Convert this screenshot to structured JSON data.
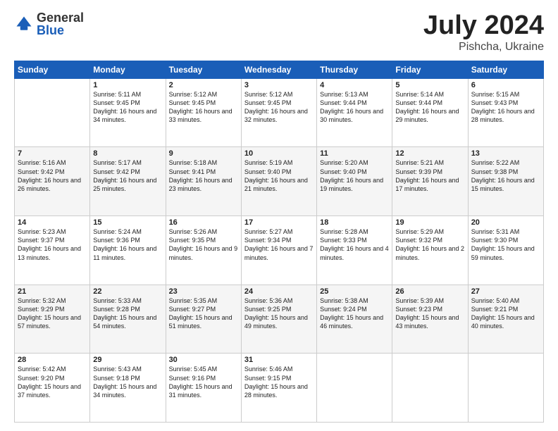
{
  "logo": {
    "general": "General",
    "blue": "Blue"
  },
  "title": {
    "month_year": "July 2024",
    "location": "Pishcha, Ukraine"
  },
  "days_of_week": [
    "Sunday",
    "Monday",
    "Tuesday",
    "Wednesday",
    "Thursday",
    "Friday",
    "Saturday"
  ],
  "weeks": [
    [
      {
        "day": "",
        "sunrise": "",
        "sunset": "",
        "daylight": ""
      },
      {
        "day": "1",
        "sunrise": "Sunrise: 5:11 AM",
        "sunset": "Sunset: 9:45 PM",
        "daylight": "Daylight: 16 hours and 34 minutes."
      },
      {
        "day": "2",
        "sunrise": "Sunrise: 5:12 AM",
        "sunset": "Sunset: 9:45 PM",
        "daylight": "Daylight: 16 hours and 33 minutes."
      },
      {
        "day": "3",
        "sunrise": "Sunrise: 5:12 AM",
        "sunset": "Sunset: 9:45 PM",
        "daylight": "Daylight: 16 hours and 32 minutes."
      },
      {
        "day": "4",
        "sunrise": "Sunrise: 5:13 AM",
        "sunset": "Sunset: 9:44 PM",
        "daylight": "Daylight: 16 hours and 30 minutes."
      },
      {
        "day": "5",
        "sunrise": "Sunrise: 5:14 AM",
        "sunset": "Sunset: 9:44 PM",
        "daylight": "Daylight: 16 hours and 29 minutes."
      },
      {
        "day": "6",
        "sunrise": "Sunrise: 5:15 AM",
        "sunset": "Sunset: 9:43 PM",
        "daylight": "Daylight: 16 hours and 28 minutes."
      }
    ],
    [
      {
        "day": "7",
        "sunrise": "Sunrise: 5:16 AM",
        "sunset": "Sunset: 9:42 PM",
        "daylight": "Daylight: 16 hours and 26 minutes."
      },
      {
        "day": "8",
        "sunrise": "Sunrise: 5:17 AM",
        "sunset": "Sunset: 9:42 PM",
        "daylight": "Daylight: 16 hours and 25 minutes."
      },
      {
        "day": "9",
        "sunrise": "Sunrise: 5:18 AM",
        "sunset": "Sunset: 9:41 PM",
        "daylight": "Daylight: 16 hours and 23 minutes."
      },
      {
        "day": "10",
        "sunrise": "Sunrise: 5:19 AM",
        "sunset": "Sunset: 9:40 PM",
        "daylight": "Daylight: 16 hours and 21 minutes."
      },
      {
        "day": "11",
        "sunrise": "Sunrise: 5:20 AM",
        "sunset": "Sunset: 9:40 PM",
        "daylight": "Daylight: 16 hours and 19 minutes."
      },
      {
        "day": "12",
        "sunrise": "Sunrise: 5:21 AM",
        "sunset": "Sunset: 9:39 PM",
        "daylight": "Daylight: 16 hours and 17 minutes."
      },
      {
        "day": "13",
        "sunrise": "Sunrise: 5:22 AM",
        "sunset": "Sunset: 9:38 PM",
        "daylight": "Daylight: 16 hours and 15 minutes."
      }
    ],
    [
      {
        "day": "14",
        "sunrise": "Sunrise: 5:23 AM",
        "sunset": "Sunset: 9:37 PM",
        "daylight": "Daylight: 16 hours and 13 minutes."
      },
      {
        "day": "15",
        "sunrise": "Sunrise: 5:24 AM",
        "sunset": "Sunset: 9:36 PM",
        "daylight": "Daylight: 16 hours and 11 minutes."
      },
      {
        "day": "16",
        "sunrise": "Sunrise: 5:26 AM",
        "sunset": "Sunset: 9:35 PM",
        "daylight": "Daylight: 16 hours and 9 minutes."
      },
      {
        "day": "17",
        "sunrise": "Sunrise: 5:27 AM",
        "sunset": "Sunset: 9:34 PM",
        "daylight": "Daylight: 16 hours and 7 minutes."
      },
      {
        "day": "18",
        "sunrise": "Sunrise: 5:28 AM",
        "sunset": "Sunset: 9:33 PM",
        "daylight": "Daylight: 16 hours and 4 minutes."
      },
      {
        "day": "19",
        "sunrise": "Sunrise: 5:29 AM",
        "sunset": "Sunset: 9:32 PM",
        "daylight": "Daylight: 16 hours and 2 minutes."
      },
      {
        "day": "20",
        "sunrise": "Sunrise: 5:31 AM",
        "sunset": "Sunset: 9:30 PM",
        "daylight": "Daylight: 15 hours and 59 minutes."
      }
    ],
    [
      {
        "day": "21",
        "sunrise": "Sunrise: 5:32 AM",
        "sunset": "Sunset: 9:29 PM",
        "daylight": "Daylight: 15 hours and 57 minutes."
      },
      {
        "day": "22",
        "sunrise": "Sunrise: 5:33 AM",
        "sunset": "Sunset: 9:28 PM",
        "daylight": "Daylight: 15 hours and 54 minutes."
      },
      {
        "day": "23",
        "sunrise": "Sunrise: 5:35 AM",
        "sunset": "Sunset: 9:27 PM",
        "daylight": "Daylight: 15 hours and 51 minutes."
      },
      {
        "day": "24",
        "sunrise": "Sunrise: 5:36 AM",
        "sunset": "Sunset: 9:25 PM",
        "daylight": "Daylight: 15 hours and 49 minutes."
      },
      {
        "day": "25",
        "sunrise": "Sunrise: 5:38 AM",
        "sunset": "Sunset: 9:24 PM",
        "daylight": "Daylight: 15 hours and 46 minutes."
      },
      {
        "day": "26",
        "sunrise": "Sunrise: 5:39 AM",
        "sunset": "Sunset: 9:23 PM",
        "daylight": "Daylight: 15 hours and 43 minutes."
      },
      {
        "day": "27",
        "sunrise": "Sunrise: 5:40 AM",
        "sunset": "Sunset: 9:21 PM",
        "daylight": "Daylight: 15 hours and 40 minutes."
      }
    ],
    [
      {
        "day": "28",
        "sunrise": "Sunrise: 5:42 AM",
        "sunset": "Sunset: 9:20 PM",
        "daylight": "Daylight: 15 hours and 37 minutes."
      },
      {
        "day": "29",
        "sunrise": "Sunrise: 5:43 AM",
        "sunset": "Sunset: 9:18 PM",
        "daylight": "Daylight: 15 hours and 34 minutes."
      },
      {
        "day": "30",
        "sunrise": "Sunrise: 5:45 AM",
        "sunset": "Sunset: 9:16 PM",
        "daylight": "Daylight: 15 hours and 31 minutes."
      },
      {
        "day": "31",
        "sunrise": "Sunrise: 5:46 AM",
        "sunset": "Sunset: 9:15 PM",
        "daylight": "Daylight: 15 hours and 28 minutes."
      },
      {
        "day": "",
        "sunrise": "",
        "sunset": "",
        "daylight": ""
      },
      {
        "day": "",
        "sunrise": "",
        "sunset": "",
        "daylight": ""
      },
      {
        "day": "",
        "sunrise": "",
        "sunset": "",
        "daylight": ""
      }
    ]
  ]
}
